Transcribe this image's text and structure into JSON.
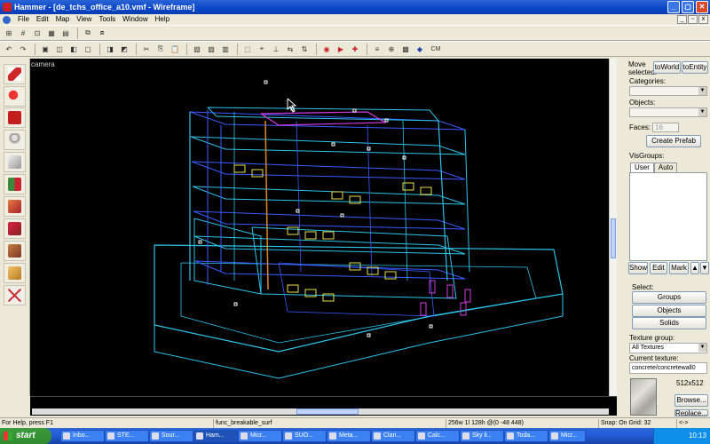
{
  "window": {
    "title": "Hammer - [de_tchs_office_a10.vmf - Wireframe]"
  },
  "menu": [
    "File",
    "Edit",
    "Map",
    "View",
    "Tools",
    "Window",
    "Help"
  ],
  "toolbar2": {
    "cm_label": "CM"
  },
  "viewport": {
    "label": "camera"
  },
  "right_panel": {
    "move_selected_label": "Move selected:",
    "to_world_label": "toWorld",
    "to_entity_label": "toEntity",
    "categories_label": "Categories:",
    "objects_label": "Objects:",
    "faces_label": "Faces:",
    "faces_value": "16",
    "create_prefab_label": "Create Prefab",
    "visgroups_label": "VisGroups:",
    "tab_user": "User",
    "tab_auto": "Auto",
    "show_label": "Show",
    "edit_label": "Edit",
    "mark_label": "Mark",
    "select_label": "Select:",
    "groups_label": "Groups",
    "objects_btn_label": "Objects",
    "solids_label": "Solids",
    "texture_group_label": "Texture group:",
    "texture_group_value": "All Textures",
    "current_texture_label": "Current texture:",
    "current_texture_value": "concrete/concretewall0",
    "texture_size": "512x512",
    "browse_label": "Browse...",
    "replace_label": "Replace..."
  },
  "status": {
    "help": "For Help, press F1",
    "selection": "func_breakable_surf",
    "dims": "256w 1l 128h @(0 -48 448)",
    "snap": "Snap: On Grid: 32",
    "coords": "<->"
  },
  "taskbar": {
    "start_label": "start",
    "items": [
      "Inbo...",
      "STE...",
      "Sour...",
      "Ham...",
      "Micr...",
      "SUO...",
      "Meta...",
      "Clari...",
      "Calc...",
      "Sky li...",
      "Toda...",
      "Micr..."
    ],
    "clock": "10:13"
  },
  "colors": {
    "titlebar": "#0a46c8",
    "viewport_bg": "#000000",
    "wire_cyan": "#2fc4ea",
    "wire_blue": "#3a5cff",
    "wire_yellow": "#e8e14a",
    "wire_magenta": "#d23be0",
    "wire_orange": "#d98a2a"
  },
  "icons": {
    "tools": [
      "pointer-tool-icon",
      "magnify-tool-icon",
      "camera-tool-icon",
      "entity-tool-icon",
      "block-tool-icon",
      "texture-app-icon",
      "apply-texture-icon",
      "decal-tool-icon",
      "overlay-tool-icon",
      "clipping-tool-icon",
      "vertex-tool-icon"
    ]
  }
}
